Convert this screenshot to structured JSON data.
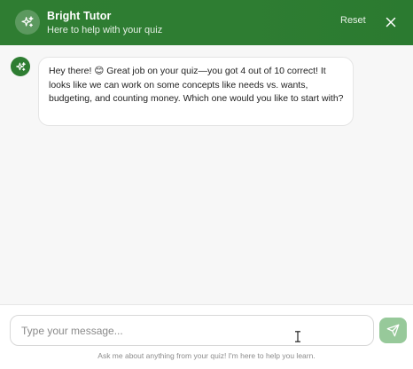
{
  "header": {
    "title": "Bright Tutor",
    "subtitle": "Here to help with your quiz",
    "reset_label": "Reset",
    "avatar_icon": "sparkles-icon",
    "close_icon": "close-icon",
    "background_color": "#2e7d32"
  },
  "messages": [
    {
      "sender": "bot",
      "avatar_icon": "sparkles-icon",
      "text": "Hey there! 😊 Great job on your quiz—you got 4 out of 10 correct! It looks like we can work on some concepts like needs vs. wants, budgeting, and counting money. Which one would you like to start with?"
    }
  ],
  "composer": {
    "placeholder": "Type your message...",
    "value": "",
    "send_icon": "send-icon",
    "send_color": "#97c99a",
    "footnote": "Ask me about anything from your quiz! I'm here to help you learn."
  }
}
